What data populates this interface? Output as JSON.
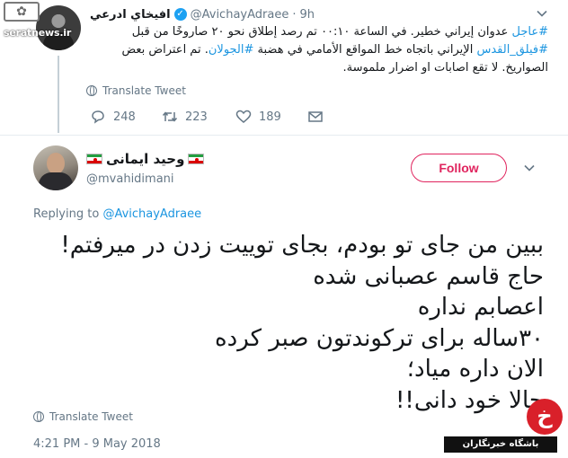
{
  "parent_tweet": {
    "display_name": "افيخاي ادرعي",
    "handle": "@AvichayAdraee",
    "time": "9h",
    "body_lines": [
      [
        {
          "t": "#عاجل",
          "h": true
        },
        {
          "t": " عدوان إيراني خطير. في الساعة ٠٠:١٠ تم رصد إطلاق نحو ٢٠ صاروخًا من قبل",
          "h": false
        }
      ],
      [
        {
          "t": "#فيلق_القدس",
          "h": true
        },
        {
          "t": " الإيراني باتجاه خط المواقع الأمامي في هضبة ",
          "h": false
        },
        {
          "t": "#الجولان",
          "h": true
        },
        {
          "t": ". تم اعتراض بعض",
          "h": false
        }
      ],
      [
        {
          "t": "الصواريخ. لا تقع اصابات او اضرار ملموسة.",
          "h": false
        }
      ]
    ],
    "translate_label": "Translate Tweet",
    "replies": "248",
    "retweets": "223",
    "likes": "189",
    "watermark": "seratnews.ir"
  },
  "reply_tweet": {
    "display_name": "وحید ایمانی",
    "handle": "@mvahidimani",
    "follow_label": "Follow",
    "replying_prefix": "Replying to",
    "replying_to": "@AvichayAdraee",
    "body_lines": [
      "ببین من جای تو بودم، بجای توییت زدن در میرفتم!",
      "حاج قاسم عصبانی شده",
      "اعصابم نداره",
      "۳۰ساله برای ترکوندتون صبر کرده",
      "الان داره میاد؛",
      "حالا خود دانی!!"
    ],
    "translate_label": "Translate Tweet",
    "timestamp": "4:21 PM - 9 May 2018"
  },
  "site_logo": {
    "text": "باشگاه خبرنگاران",
    "glyph": "خ"
  },
  "colors": {
    "link_blue": "#1b95e0",
    "follow_red": "#e0245e",
    "meta_gray": "#657786",
    "text_dark": "#14171a"
  }
}
